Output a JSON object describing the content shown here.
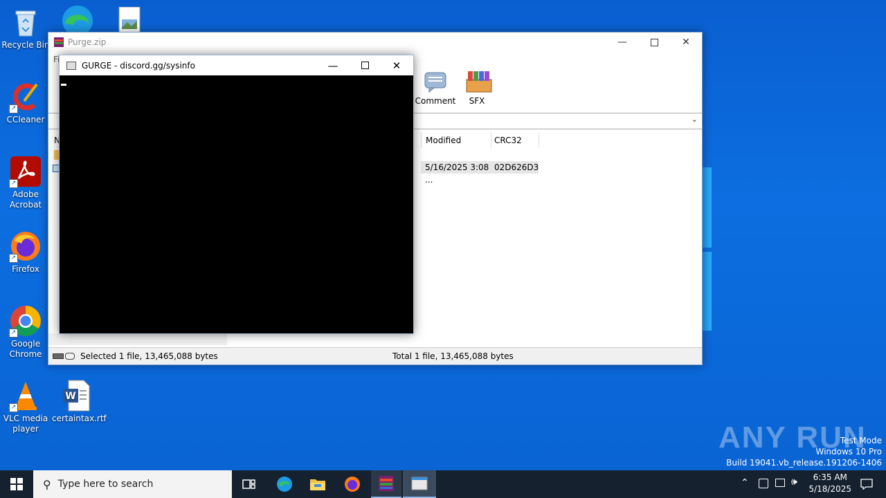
{
  "desktop": {
    "icons": [
      {
        "label": "Recycle Bin"
      },
      {
        "label": "CCleaner"
      },
      {
        "label": "Adobe Acrobat"
      },
      {
        "label": "Firefox"
      },
      {
        "label": "Google Chrome"
      },
      {
        "label": "VLC media player"
      },
      {
        "label": "certaintax.rtf"
      }
    ]
  },
  "winrar": {
    "title": "Purge.zip",
    "menu_partial": "Fi",
    "toolbar": {
      "comment": "Comment",
      "sfx": "SFX"
    },
    "columns": {
      "name_partial": "N",
      "modified": "Modified",
      "crc32": "CRC32"
    },
    "row": {
      "modified": "5/16/2025 3:08 ...",
      "crc32": "02D626D3"
    },
    "status": {
      "left": "Selected 1 file, 13,465,088 bytes",
      "right": "Total 1 file, 13,465,088 bytes"
    }
  },
  "console": {
    "title": "GURGE - discord.gg/sysinfo"
  },
  "taskbar": {
    "search_placeholder": "Type here to search",
    "time": "6:35 AM",
    "date": "5/18/2025"
  },
  "watermark": {
    "brand": "ANY RUN",
    "line1": "Test Mode",
    "line2": "Windows 10 Pro",
    "line3": "Build 19041.vb_release.191206-1406"
  },
  "colors": {
    "desktop": "#0a63d2",
    "taskbar": "#15212f",
    "console_bg": "#000000"
  }
}
